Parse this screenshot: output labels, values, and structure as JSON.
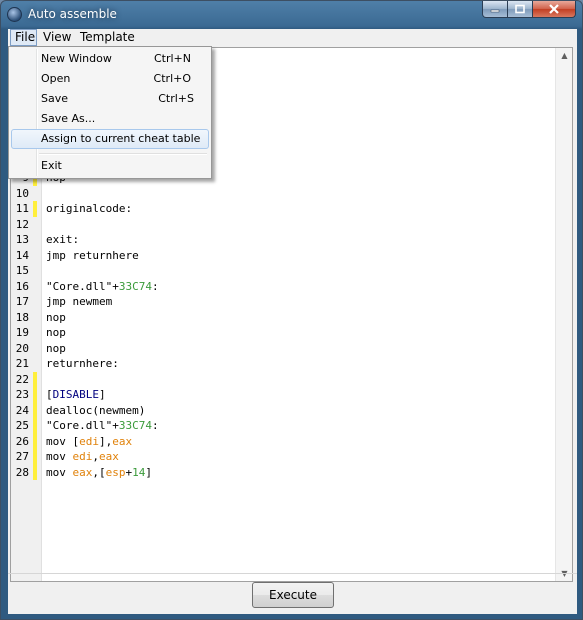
{
  "window": {
    "title": "Auto assemble"
  },
  "menubar": {
    "items": [
      "File",
      "View",
      "Template"
    ]
  },
  "file_menu": {
    "items": [
      {
        "label": "New Window",
        "shortcut": "Ctrl+N"
      },
      {
        "label": "Open",
        "shortcut": "Ctrl+O"
      },
      {
        "label": "Save",
        "shortcut": "Ctrl+S"
      },
      {
        "label": "Save As...",
        "shortcut": ""
      },
      {
        "label": "Assign to current cheat table",
        "shortcut": ""
      },
      {
        "label": "Exit",
        "shortcut": ""
      }
    ]
  },
  "editor": {
    "lines": [
      {
        "n": "9",
        "code": "nop",
        "marked": true
      },
      {
        "n": "10",
        "code": "",
        "marked": false
      },
      {
        "n": "11",
        "code": "originalcode:",
        "marked": true
      },
      {
        "n": "12",
        "code": "",
        "marked": false
      },
      {
        "n": "13",
        "code": "exit:",
        "marked": false
      },
      {
        "n": "14",
        "code": "jmp returnhere",
        "marked": false
      },
      {
        "n": "15",
        "code": "",
        "marked": false
      },
      {
        "n": "16",
        "code": "\"Core.dll\"+33C74:",
        "marked": false
      },
      {
        "n": "17",
        "code": "jmp newmem",
        "marked": false
      },
      {
        "n": "18",
        "code": "nop",
        "marked": false
      },
      {
        "n": "19",
        "code": "nop",
        "marked": false
      },
      {
        "n": "20",
        "code": "nop",
        "marked": false
      },
      {
        "n": "21",
        "code": "returnhere:",
        "marked": false
      },
      {
        "n": "22",
        "code": "",
        "marked": true
      },
      {
        "n": "23",
        "code": "[DISABLE]",
        "marked": true
      },
      {
        "n": "24",
        "code": "dealloc(newmem)",
        "marked": true
      },
      {
        "n": "25",
        "code": "\"Core.dll\"+33C74:",
        "marked": true
      },
      {
        "n": "26",
        "code": "mov [edi],eax",
        "marked": true
      },
      {
        "n": "27",
        "code": "mov edi,eax",
        "marked": true
      },
      {
        "n": "28",
        "code": "mov eax,[esp+14]",
        "marked": true
      }
    ]
  },
  "footer": {
    "execute_label": "Execute"
  },
  "colors": {
    "number": "#3a9a3a",
    "register": "#e0820b",
    "keyword": "#00007f",
    "marker": "#ffef3c"
  },
  "icons": {
    "app": "cheat-engine-icon",
    "minimize": "minimize-icon",
    "maximize": "maximize-icon",
    "close": "close-icon"
  }
}
